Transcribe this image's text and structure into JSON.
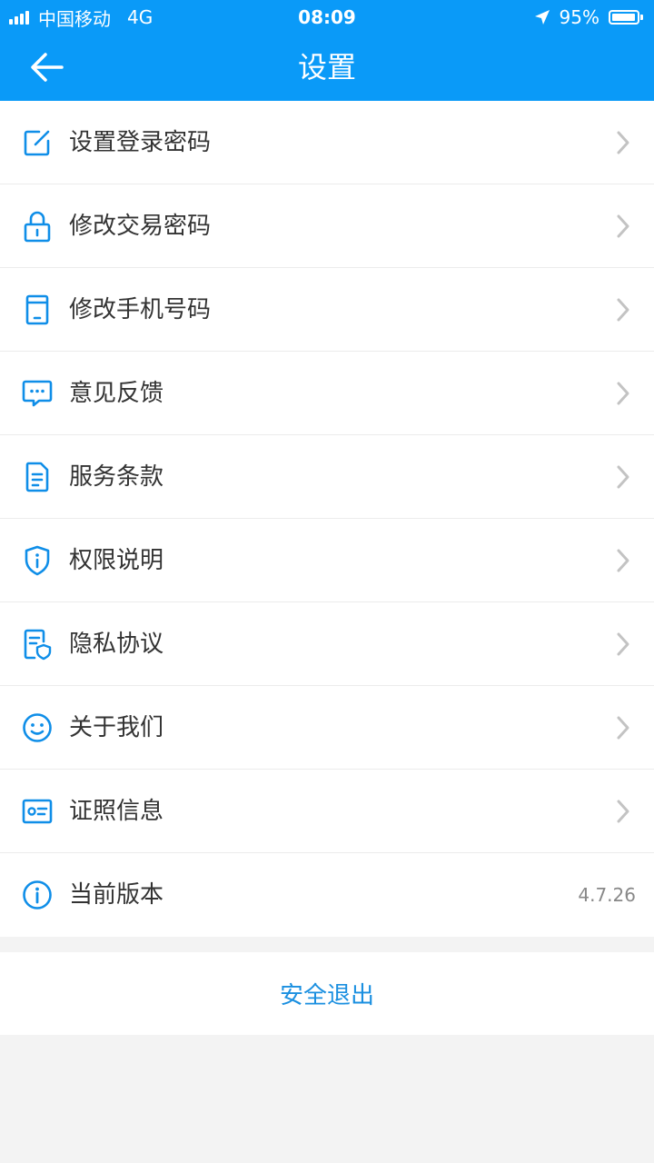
{
  "colors": {
    "accent": "#0a9af8",
    "icon": "#0f8ee8",
    "chevron": "#c3c3c3",
    "page_background": "#f3f3f3",
    "logout_text": "#1a8fe0"
  },
  "status_bar": {
    "carrier": "中国移动",
    "network": "4G",
    "time": "08:09",
    "battery": "95%",
    "battery_level": 0.95
  },
  "nav": {
    "title": "设置",
    "back_icon": "arrow-left-icon"
  },
  "settings": {
    "items": [
      {
        "label": "设置登录密码",
        "icon": "edit-square-icon"
      },
      {
        "label": "修改交易密码",
        "icon": "lock-icon"
      },
      {
        "label": "修改手机号码",
        "icon": "phone-icon"
      },
      {
        "label": "意见反馈",
        "icon": "chat-bubble-icon"
      },
      {
        "label": "服务条款",
        "icon": "document-icon"
      },
      {
        "label": "权限说明",
        "icon": "shield-info-icon"
      },
      {
        "label": "隐私协议",
        "icon": "privacy-document-icon"
      },
      {
        "label": "关于我们",
        "icon": "smiley-icon"
      },
      {
        "label": "证照信息",
        "icon": "id-card-icon"
      },
      {
        "label": "当前版本",
        "icon": "info-circle-icon",
        "value": "4.7.26"
      }
    ]
  },
  "logout": {
    "label": "安全退出"
  }
}
